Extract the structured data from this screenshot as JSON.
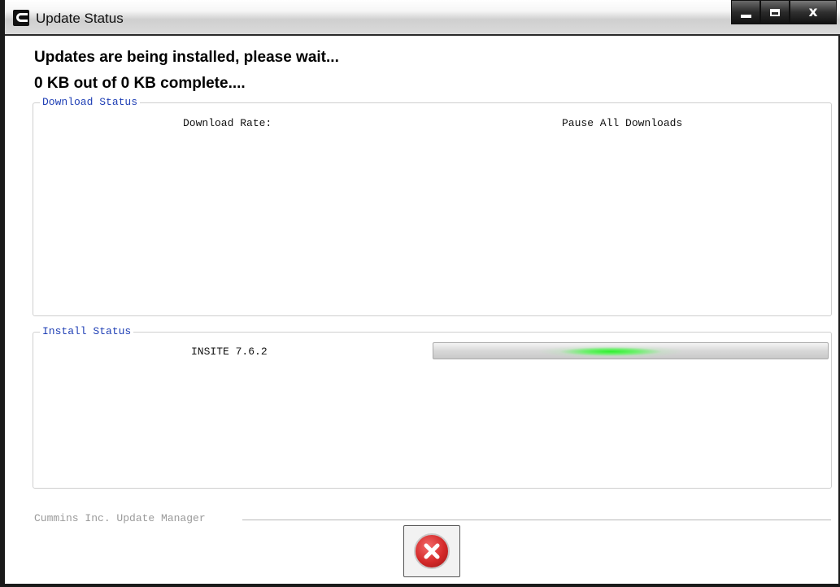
{
  "window": {
    "title": "Update Status",
    "controls": {
      "close": "x"
    }
  },
  "status": {
    "heading": "Updates are being installed, please wait...",
    "progress_text": "0 KB out of 0 KB complete...."
  },
  "download_group": {
    "legend": "Download Status",
    "rate_label": "Download Rate:",
    "pause_label": "Pause All Downloads"
  },
  "install_group": {
    "legend": "Install Status",
    "item_name": "INSITE 7.6.2",
    "progress_state": "indeterminate"
  },
  "footer": {
    "label": "Cummins Inc. Update Manager"
  },
  "icons": {
    "app": "cummins-logo-icon",
    "cancel": "cancel-x-icon"
  },
  "colors": {
    "legend": "#1f3fb5",
    "progress_glow": "#2ff02f",
    "cancel": "#d42a2a"
  }
}
